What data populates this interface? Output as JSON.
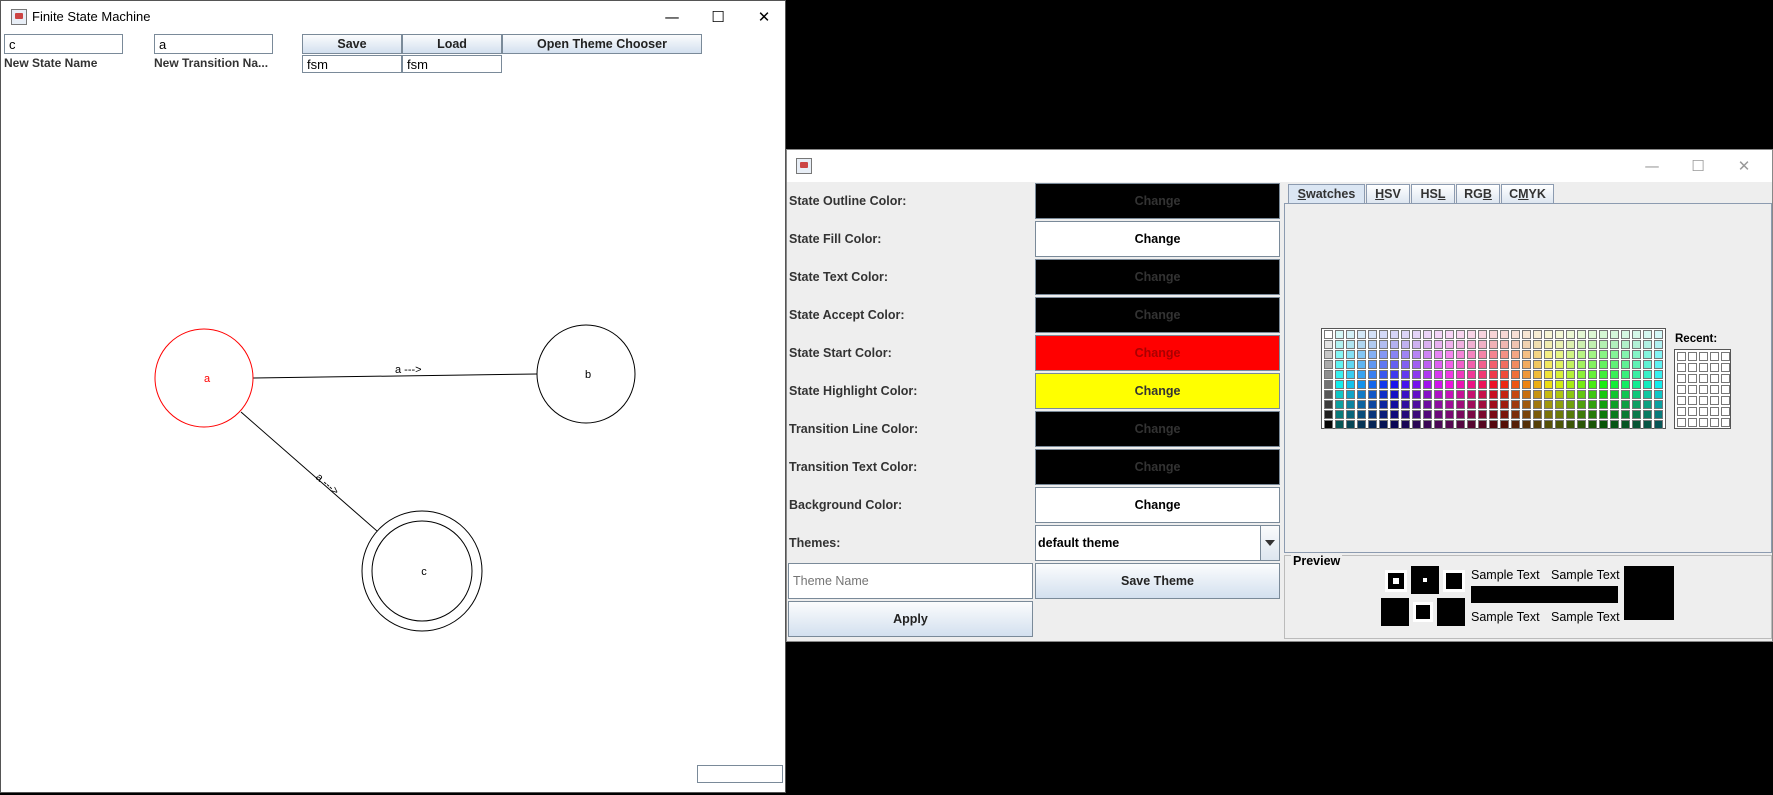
{
  "fsm_window": {
    "title": "Finite State Machine",
    "controls": {
      "minimize": "—",
      "maximize": "☐",
      "close": "✕"
    },
    "toolbar": {
      "state_name_value": "c",
      "transition_name_value": "a",
      "state_name_label": "New State Name",
      "transition_name_label": "New Transition Na...",
      "save_label": "Save",
      "load_label": "Load",
      "theme_chooser_label": "Open Theme Chooser",
      "save_file_value": "fsm",
      "load_file_value": "fsm"
    },
    "states": [
      {
        "name": "a",
        "accept": false,
        "highlighted": true
      },
      {
        "name": "b",
        "accept": false,
        "highlighted": false
      },
      {
        "name": "c",
        "accept": true,
        "highlighted": false
      }
    ],
    "transitions": [
      {
        "from": "a",
        "to": "b",
        "label": "a --->"
      },
      {
        "from": "a",
        "to": "c",
        "label": "a --->"
      }
    ],
    "status_value": ""
  },
  "theme_window": {
    "title": "",
    "controls": {
      "minimize": "—",
      "maximize": "☐",
      "close": "✕"
    },
    "rows": [
      {
        "label": "State Outline Color:",
        "button": "Change",
        "color": "#000000",
        "text_color": "#333333"
      },
      {
        "label": "State Fill Color:",
        "button": "Change",
        "color": "#ffffff",
        "text_color": "#000000"
      },
      {
        "label": "State Text Color:",
        "button": "Change",
        "color": "#000000",
        "text_color": "#333333"
      },
      {
        "label": "State Accept Color:",
        "button": "Change",
        "color": "#000000",
        "text_color": "#333333"
      },
      {
        "label": "State Start Color:",
        "button": "Change",
        "color": "#ff0000",
        "text_color": "#aa0000"
      },
      {
        "label": "State Highlight Color:",
        "button": "Change",
        "color": "#ffff00",
        "text_color": "#333333"
      },
      {
        "label": "Transition Line Color:",
        "button": "Change",
        "color": "#000000",
        "text_color": "#333333"
      },
      {
        "label": "Transition Text Color:",
        "button": "Change",
        "color": "#000000",
        "text_color": "#333333"
      },
      {
        "label": "Background Color:",
        "button": "Change",
        "color": "#ffffff",
        "text_color": "#000000"
      }
    ],
    "themes_label": "Themes:",
    "theme_selected": "default theme",
    "theme_name_placeholder": "Theme Name",
    "save_theme_label": "Save Theme",
    "apply_label": "Apply",
    "chooser": {
      "tabs": [
        "Swatches",
        "HSV",
        "HSL",
        "RGB",
        "CMYK"
      ],
      "active_tab": "Swatches",
      "recent_label": "Recent:",
      "preview_label": "Preview",
      "sample_text": "Sample Text"
    }
  }
}
